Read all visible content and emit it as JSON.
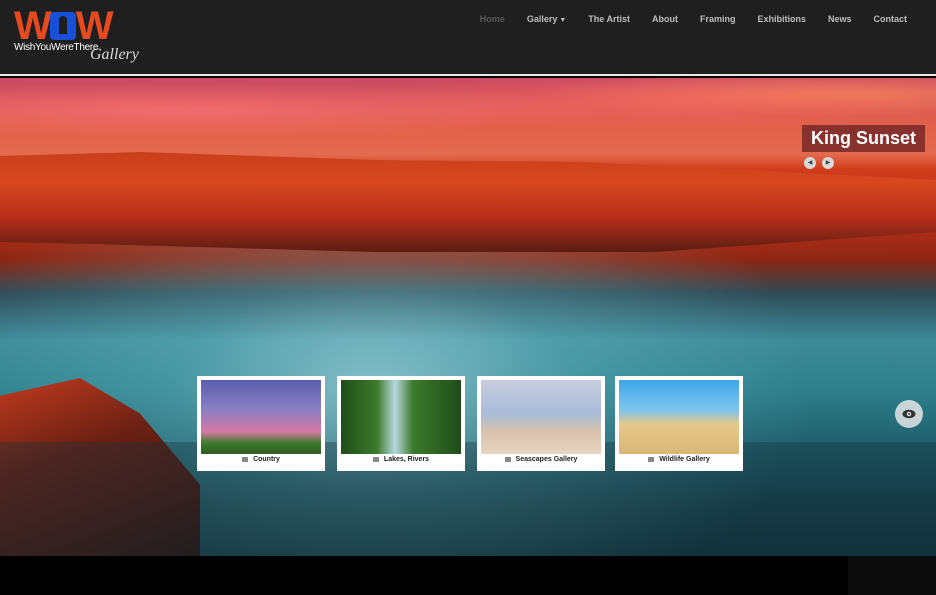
{
  "logo": {
    "letters": "WOW",
    "tagline": "WishYouWereThere",
    "script": "Gallery"
  },
  "nav": {
    "items": [
      {
        "label": "Home",
        "active": true
      },
      {
        "label": "Gallery",
        "dropdown": true
      },
      {
        "label": "The Artist"
      },
      {
        "label": "About"
      },
      {
        "label": "Framing"
      },
      {
        "label": "Exhibitions"
      },
      {
        "label": "News"
      },
      {
        "label": "Contact"
      }
    ],
    "caret": "▼"
  },
  "hero": {
    "title": "King Sunset",
    "prev_icon": "◀",
    "next_icon": "▶",
    "view_icon": "eye-icon"
  },
  "thumbnails": [
    {
      "label": "Country"
    },
    {
      "label": "Lakes, Rivers"
    },
    {
      "label": "Seascapes Gallery"
    },
    {
      "label": "Wildlife Gallery"
    }
  ],
  "colors": {
    "accent_red": "#e84a1f",
    "logo_blue": "#1a4fd8",
    "header_bg": "#1f1f1f",
    "title_badge": "#782828"
  }
}
